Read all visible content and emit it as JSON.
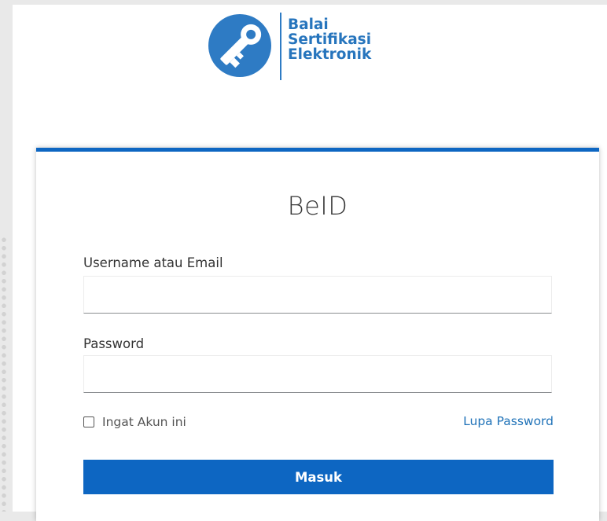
{
  "logo": {
    "line1": "Balai",
    "line2": "Sertifikasi",
    "line3": "Elektronik",
    "icon": "key-icon",
    "color": "#2e7bc4"
  },
  "form": {
    "title": "BeID",
    "username_label": "Username atau Email",
    "username_value": "",
    "password_label": "Password",
    "password_value": "",
    "remember_label": "Ingat Akun ini",
    "remember_checked": false,
    "forgot_link": "Lupa Password",
    "submit_label": "Masuk",
    "accent_color": "#0d66c2"
  }
}
